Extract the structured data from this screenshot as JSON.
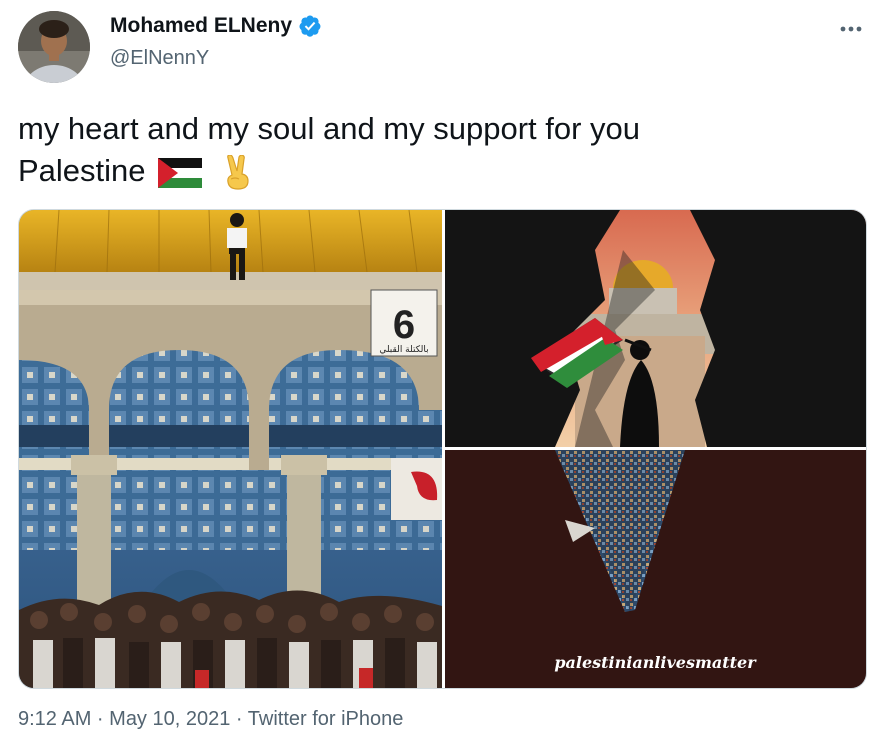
{
  "author": {
    "display_name": "Mohamed ELNeny",
    "handle": "@ElNennY",
    "avatar_icon": "user-avatar",
    "verified_icon": "verified-badge-icon",
    "verified_color": "#1d9bf0"
  },
  "more_icon": "more-options-icon",
  "tweet": {
    "line1": "my heart and my soul and my support for you",
    "line2": "Palestine",
    "emojis": [
      "palestine-flag-icon",
      "victory-hand-icon"
    ]
  },
  "media": {
    "photo1": {
      "icon": "dome-of-the-rock-crowd-photo",
      "sign_text": "6",
      "sign_caption": "بالكتلة القبلي"
    },
    "photo2": {
      "icon": "flag-in-rock-crevice-photo"
    },
    "photo3": {
      "icon": "crowd-in-v-shape-photo",
      "caption": "palestinianlivesmatter"
    }
  },
  "footer": {
    "timestamp": "9:12 AM · May 10, 2021 · Twitter for iPhone"
  },
  "colors": {
    "text": "#0f1419",
    "secondary": "#536471",
    "border": "#cfd9de"
  }
}
